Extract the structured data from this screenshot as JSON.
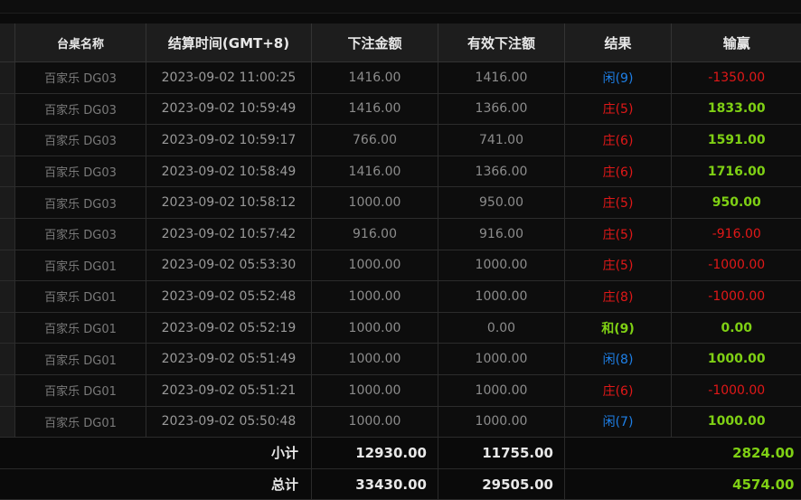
{
  "headers": {
    "table": "台桌名称",
    "settle_time": "结算时间(GMT+8)",
    "bet_amount": "下注金额",
    "valid_bet": "有效下注额",
    "result": "结果",
    "win_loss": "输赢"
  },
  "rows": [
    {
      "table": "百家乐 DG03",
      "time": "2023-09-02 11:00:25",
      "bet": "1416.00",
      "valid": "1416.00",
      "result": "闲(9)",
      "result_type": "player",
      "winloss": "-1350.00",
      "wl_type": "lose"
    },
    {
      "table": "百家乐 DG03",
      "time": "2023-09-02 10:59:49",
      "bet": "1416.00",
      "valid": "1366.00",
      "result": "庄(5)",
      "result_type": "banker",
      "winloss": "1833.00",
      "wl_type": "win"
    },
    {
      "table": "百家乐 DG03",
      "time": "2023-09-02 10:59:17",
      "bet": "766.00",
      "valid": "741.00",
      "result": "庄(6)",
      "result_type": "banker",
      "winloss": "1591.00",
      "wl_type": "win"
    },
    {
      "table": "百家乐 DG03",
      "time": "2023-09-02 10:58:49",
      "bet": "1416.00",
      "valid": "1366.00",
      "result": "庄(6)",
      "result_type": "banker",
      "winloss": "1716.00",
      "wl_type": "win"
    },
    {
      "table": "百家乐 DG03",
      "time": "2023-09-02 10:58:12",
      "bet": "1000.00",
      "valid": "950.00",
      "result": "庄(5)",
      "result_type": "banker",
      "winloss": "950.00",
      "wl_type": "win"
    },
    {
      "table": "百家乐 DG03",
      "time": "2023-09-02 10:57:42",
      "bet": "916.00",
      "valid": "916.00",
      "result": "庄(5)",
      "result_type": "banker",
      "winloss": "-916.00",
      "wl_type": "lose"
    },
    {
      "table": "百家乐 DG01",
      "time": "2023-09-02 05:53:30",
      "bet": "1000.00",
      "valid": "1000.00",
      "result": "庄(5)",
      "result_type": "banker",
      "winloss": "-1000.00",
      "wl_type": "lose"
    },
    {
      "table": "百家乐 DG01",
      "time": "2023-09-02 05:52:48",
      "bet": "1000.00",
      "valid": "1000.00",
      "result": "庄(8)",
      "result_type": "banker",
      "winloss": "-1000.00",
      "wl_type": "lose"
    },
    {
      "table": "百家乐 DG01",
      "time": "2023-09-02 05:52:19",
      "bet": "1000.00",
      "valid": "0.00",
      "result": "和(9)",
      "result_type": "tie",
      "winloss": "0.00",
      "wl_type": "zero"
    },
    {
      "table": "百家乐 DG01",
      "time": "2023-09-02 05:51:49",
      "bet": "1000.00",
      "valid": "1000.00",
      "result": "闲(8)",
      "result_type": "player",
      "winloss": "1000.00",
      "wl_type": "win"
    },
    {
      "table": "百家乐 DG01",
      "time": "2023-09-02 05:51:21",
      "bet": "1000.00",
      "valid": "1000.00",
      "result": "庄(6)",
      "result_type": "banker",
      "winloss": "-1000.00",
      "wl_type": "lose"
    },
    {
      "table": "百家乐 DG01",
      "time": "2023-09-02 05:50:48",
      "bet": "1000.00",
      "valid": "1000.00",
      "result": "闲(7)",
      "result_type": "player",
      "winloss": "1000.00",
      "wl_type": "win"
    }
  ],
  "subtotal": {
    "label": "小计",
    "bet": "12930.00",
    "valid": "11755.00",
    "winloss": "2824.00"
  },
  "total": {
    "label": "总计",
    "bet": "33430.00",
    "valid": "29505.00",
    "winloss": "4574.00"
  },
  "colors": {
    "player": "#1e7fe6",
    "banker": "#e01818",
    "tie": "#7fd014",
    "win": "#7fd014",
    "lose": "#e01818"
  }
}
